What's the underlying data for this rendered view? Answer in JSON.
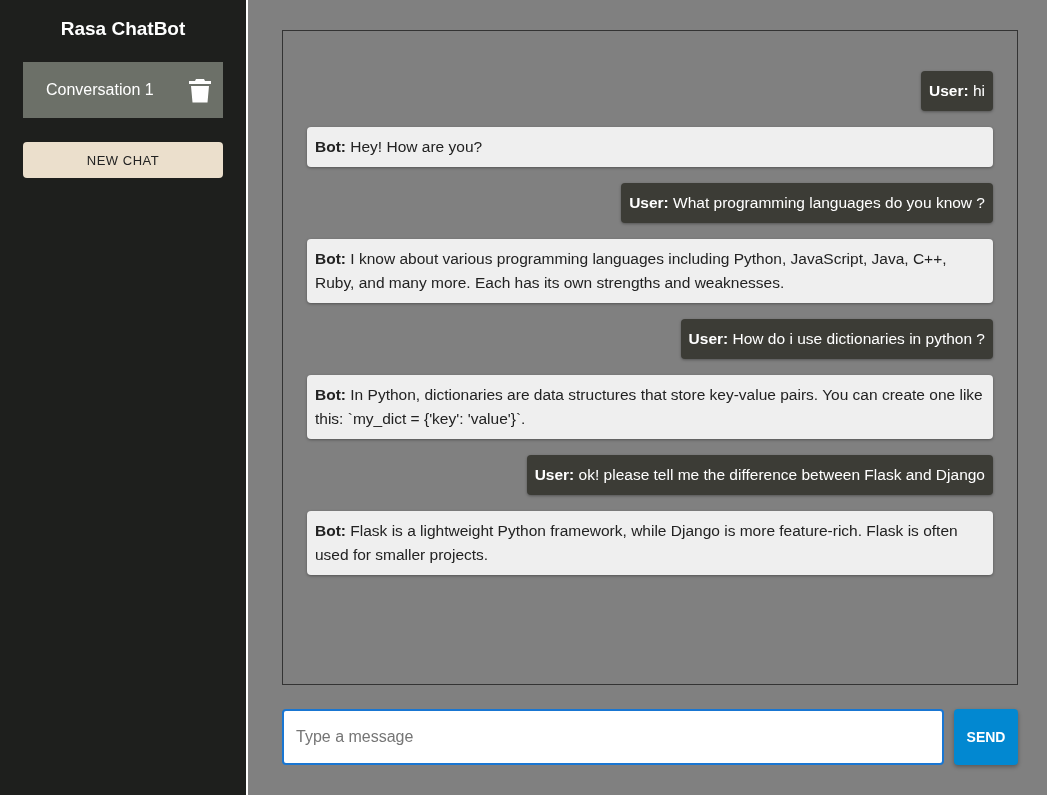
{
  "sidebar": {
    "title": "Rasa ChatBot",
    "conversations": [
      {
        "label": "Conversation 1",
        "selected": true
      }
    ],
    "new_chat_button": "NEW CHAT"
  },
  "messages": [
    {
      "kind": "user",
      "text": "**User:** hi"
    },
    {
      "kind": "bot",
      "text": "**Bot:** Hey! How are you?"
    },
    {
      "kind": "user",
      "text": "**User:** What programming languages do you know ?"
    },
    {
      "kind": "bot",
      "text": "**Bot:** I know about various programming languages including Python, JavaScript, Java, C++, Ruby, and many more. Each has its own strengths and weaknesses."
    },
    {
      "kind": "user",
      "text": "**User:** How do i use dictionaries in python ?"
    },
    {
      "kind": "bot",
      "text": "**Bot:** In Python, dictionaries are data structures that store key-value pairs. You can create one like this: `my_dict = {'key': 'value'}`."
    },
    {
      "kind": "user",
      "text": "**User:** ok! please tell me the difference between Flask and Django"
    },
    {
      "kind": "bot",
      "text": "**Bot:** Flask is a lightweight Python framework, while Django is more feature-rich. Flask is often used for smaller projects."
    }
  ],
  "composer": {
    "placeholder": "Type a message",
    "send_button": "SEND"
  }
}
